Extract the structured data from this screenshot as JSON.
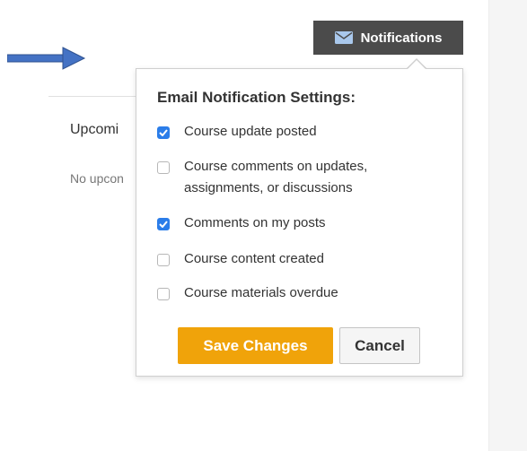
{
  "header": {
    "notifications_label": "Notifications",
    "notifications_icon": "mail-icon"
  },
  "upcoming": {
    "title": "Upcomi",
    "empty_text": "No upcon"
  },
  "popover": {
    "title": "Email Notification Settings:",
    "options": [
      {
        "label": "Course update posted",
        "checked": true
      },
      {
        "label": "Course comments on updates, assignments, or discussions",
        "checked": false
      },
      {
        "label": "Comments on my posts",
        "checked": true
      },
      {
        "label": "Course content created",
        "checked": false
      },
      {
        "label": "Course materials overdue",
        "checked": false
      }
    ],
    "save_label": "Save Changes",
    "cancel_label": "Cancel"
  },
  "annotation": {
    "arrow_icon": "arrow-right-icon",
    "arrow_color": "#4472c4"
  },
  "colors": {
    "accent": "#f0a30a",
    "checkbox_checked": "#2b7de9",
    "notifications_bg": "#4b4b4b"
  }
}
